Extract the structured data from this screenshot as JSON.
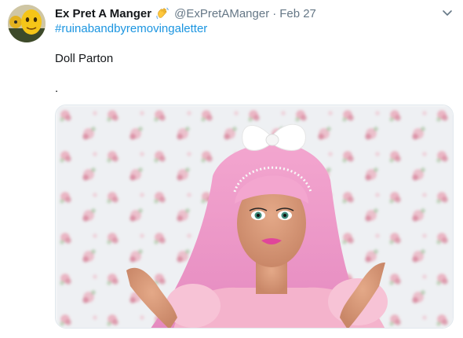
{
  "tweet": {
    "author": {
      "display_name": "Ex Pret A Manger",
      "handle": "@ExPretAManger",
      "badge_icon": "waving-hand-icon"
    },
    "separator": "·",
    "date": "Feb 27",
    "hashtag": "#ruinabandbyremovingaletter",
    "body_text": "Doll Parton",
    "body_dot": ".",
    "media": {
      "description_icon": "doll-photo"
    },
    "menu_icon": "chevron-down-icon"
  },
  "colors": {
    "link": "#1b95e0",
    "secondary_text": "#657786",
    "primary_text": "#14171a"
  }
}
